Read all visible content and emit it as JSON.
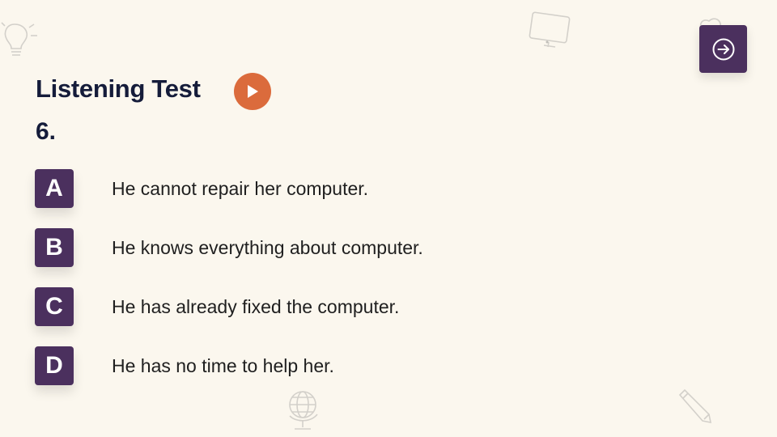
{
  "header": {
    "title": "Listening Test",
    "question_number": "6."
  },
  "controls": {
    "play_icon": "play-icon",
    "next_icon": "arrow-right-circle-icon"
  },
  "options": [
    {
      "letter": "A",
      "text": "He cannot repair her computer."
    },
    {
      "letter": "B",
      "text": "He knows everything about computer."
    },
    {
      "letter": "C",
      "text": "He has already fixed the computer."
    },
    {
      "letter": "D",
      "text": "He has no time to help her."
    }
  ],
  "colors": {
    "background": "#fbf7ee",
    "accent_purple": "#4b305e",
    "play_orange": "#db6b3c",
    "title_navy": "#151c3a"
  }
}
